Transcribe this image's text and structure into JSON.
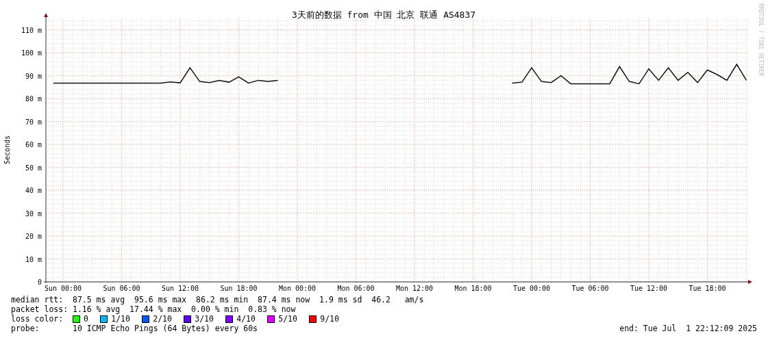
{
  "chart": {
    "credit": "RRDTOOL / TOBI OETIKER",
    "chart_data": {
      "type": "line",
      "title": "3天前的数据 from 中国 北京 联通 AS4837",
      "ylabel": "Seconds",
      "grid": true,
      "ylim": [
        0,
        115
      ],
      "yticks": [
        {
          "value": 0,
          "label": "0"
        },
        {
          "value": 10,
          "label": "10 m"
        },
        {
          "value": 20,
          "label": "20 m"
        },
        {
          "value": 30,
          "label": "30 m"
        },
        {
          "value": 40,
          "label": "40 m"
        },
        {
          "value": 50,
          "label": "50 m"
        },
        {
          "value": 60,
          "label": "60 m"
        },
        {
          "value": 70,
          "label": "70 m"
        },
        {
          "value": 80,
          "label": "80 m"
        },
        {
          "value": 90,
          "label": "90 m"
        },
        {
          "value": 100,
          "label": "100 m"
        },
        {
          "value": 110,
          "label": "110 m"
        }
      ],
      "categories": [
        null,
        "Sun 00:00",
        null,
        null,
        null,
        null,
        null,
        "Sun 06:00",
        null,
        null,
        null,
        null,
        null,
        "Sun 12:00",
        null,
        null,
        null,
        null,
        null,
        "Sun 18:00",
        null,
        null,
        null,
        null,
        null,
        "Mon 00:00",
        null,
        null,
        null,
        null,
        null,
        "Mon 06:00",
        null,
        null,
        null,
        null,
        null,
        "Mon 12:00",
        null,
        null,
        null,
        null,
        null,
        "Mon 18:00",
        null,
        null,
        null,
        null,
        null,
        "Tue 00:00",
        null,
        null,
        null,
        null,
        null,
        "Tue 06:00",
        null,
        null,
        null,
        null,
        null,
        "Tue 12:00",
        null,
        null,
        null,
        null,
        null,
        "Tue 18:00",
        null,
        null,
        null,
        null
      ],
      "series": [
        {
          "color": "#111111",
          "values": [
            86.8,
            86.8,
            86.8,
            86.8,
            86.8,
            86.8,
            86.8,
            86.8,
            86.8,
            86.8,
            86.8,
            86.8,
            87.3,
            86.9,
            93.5,
            87.5,
            87.0,
            88.0,
            87.2,
            89.5,
            86.8,
            88.0,
            87.5,
            88.0,
            null,
            null,
            null,
            null,
            null,
            null,
            null,
            null,
            null,
            null,
            null,
            null,
            null,
            null,
            null,
            null,
            null,
            null,
            null,
            null,
            null,
            null,
            null,
            86.8,
            87.2,
            93.5,
            87.5,
            87.0,
            90.0,
            86.5,
            86.5,
            86.5,
            86.5,
            86.5,
            94.0,
            87.5,
            86.5,
            93.0,
            88.0,
            93.5,
            88.0,
            91.5,
            87.0,
            92.5,
            90.5,
            88.0,
            95.0,
            88.0
          ]
        }
      ]
    }
  },
  "stats": [
    {
      "label": "median rtt:",
      "values": [
        "87.5 ms avg",
        "95.6 ms max",
        "86.2 ms min",
        "87.4 ms now",
        "1.9 ms sd",
        "46.2   am/s"
      ]
    },
    {
      "label": "packet loss:",
      "values": [
        "1.16 % avg",
        "17.44 % max",
        "0.00 % min",
        "0.83 % now"
      ]
    }
  ],
  "loss_color": {
    "label": "loss color:",
    "items": [
      {
        "label": "0",
        "color": "#26ff00"
      },
      {
        "label": "1/10",
        "color": "#00b8ff"
      },
      {
        "label": "2/10",
        "color": "#0059ff"
      },
      {
        "label": "3/10",
        "color": "#5e00ff"
      },
      {
        "label": "4/10",
        "color": "#7e00ff"
      },
      {
        "label": "5/10",
        "color": "#dd00ff"
      },
      {
        "label": "9/10",
        "color": "#ff0000"
      }
    ]
  },
  "probe": {
    "label": "probe:",
    "value": "10 ICMP Echo Pings (64 Bytes) every 60s"
  },
  "end": "end: Tue Jul  1 22:12:09 2025"
}
